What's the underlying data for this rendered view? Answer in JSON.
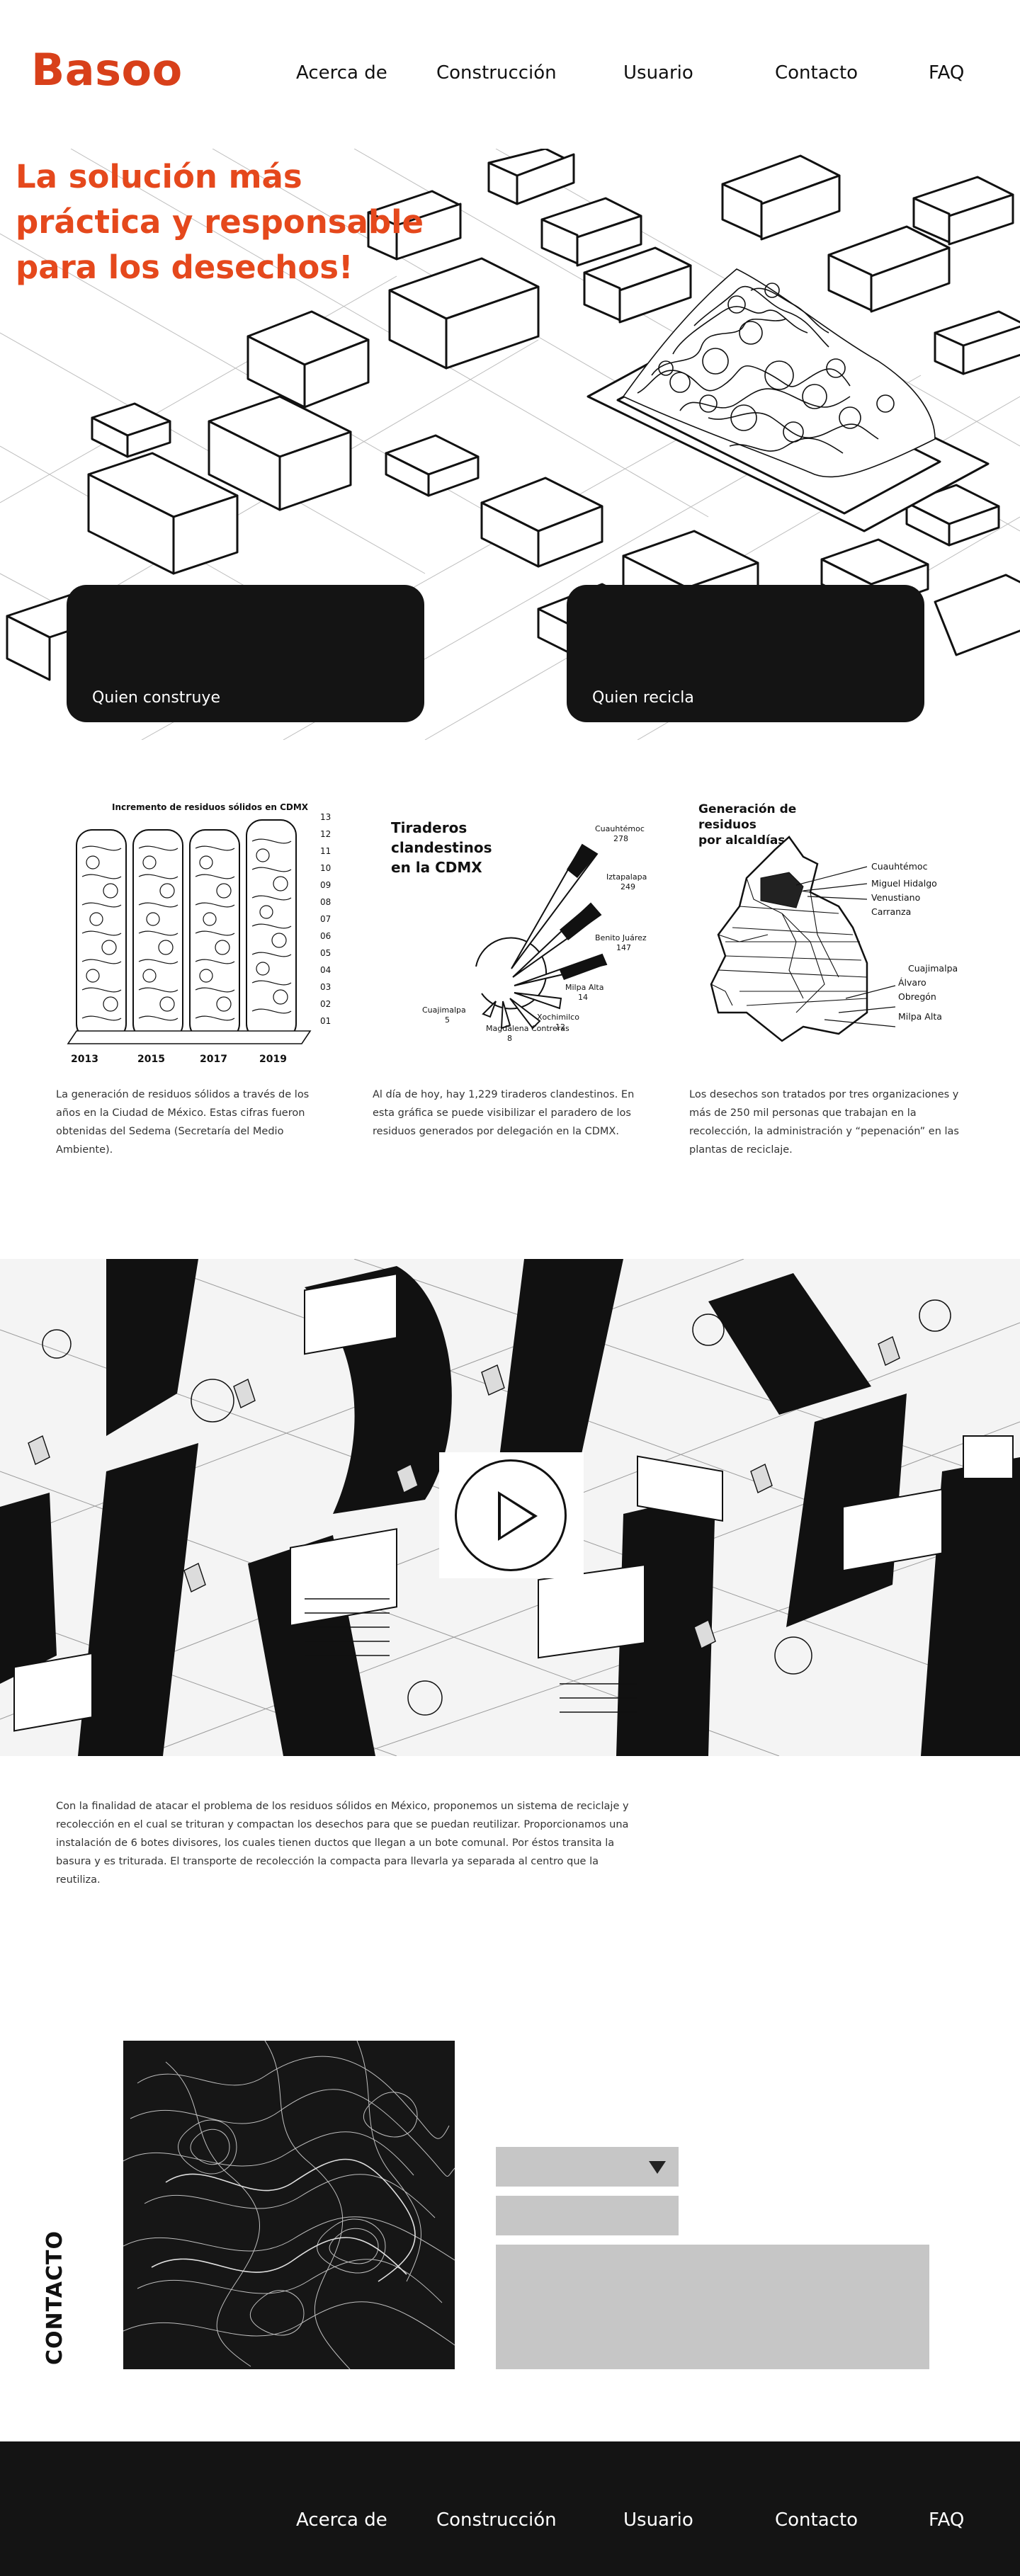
{
  "header": {
    "logo": "Basoo",
    "nav": [
      "Acerca de",
      "Construcción",
      "Usuario",
      "Contacto",
      "FAQ"
    ]
  },
  "hero": {
    "title": "La solución más práctica y responsable para los desechos!",
    "cards": [
      "Quien construye",
      "Quien recicla"
    ]
  },
  "info": {
    "fig1": {
      "title": "Incremento de residuos sólidos en CDMX",
      "years": [
        "2013",
        "2015",
        "2017",
        "2019"
      ],
      "scale": [
        "13",
        "12",
        "11",
        "10",
        "09",
        "08",
        "07",
        "06",
        "05",
        "04",
        "03",
        "02",
        "01"
      ],
      "text": "La generación de residuos sólidos a través de los años en la Ciudad de México. Estas cifras fueron obtenidas del Sedema (Secretaría del Medio Ambiente)."
    },
    "fig2": {
      "title": [
        "Tiraderos",
        "clandestinos",
        "en la CDMX"
      ],
      "labels": [
        {
          "name": "Cuauhtémoc",
          "value": "278"
        },
        {
          "name": "Iztapalapa",
          "value": "249"
        },
        {
          "name": "Benito Juárez",
          "value": "147"
        },
        {
          "name": "Milpa Alta",
          "value": "14"
        },
        {
          "name": "Xochimilco",
          "value": "12"
        },
        {
          "name": "Magdalena Contreras",
          "value": "8"
        },
        {
          "name": "Cuajimalpa",
          "value": "5"
        }
      ],
      "text": "Al día de hoy, hay 1,229 tiraderos clandestinos. En esta gráfica se puede visibilizar el paradero de los residuos generados por delegación en la CDMX."
    },
    "fig3": {
      "title": [
        "Generación de",
        "residuos",
        "por alcaldías"
      ],
      "labels": [
        "Cuauhtémoc",
        "Miguel Hidalgo",
        "Venustiano",
        "Carranza",
        "Cuajimalpa",
        "Álvaro",
        "Obregón",
        "Milpa Alta"
      ],
      "text": "Los desechos son tratados por tres organizaciones y más de 250 mil personas que trabajan en la recolección, la administración y “pepenación” en las plantas de reciclaje."
    }
  },
  "video": {
    "description": "Con la finalidad de atacar el problema de los residuos sólidos en México, proponemos un sistema de reciclaje y recolección en el cual se trituran y compactan los desechos para que se puedan reutilizar. Proporcionamos una instalación de 6 botes divisores, los cuales tienen ductos que llegan a un bote comunal. Por éstos transita la basura y es triturada. El transporte de recolección la compacta para llevarla ya separada al centro que la reutiliza."
  },
  "contact": {
    "heading": "CONTACTO"
  },
  "footer": {
    "nav": [
      "Acerca de",
      "Construcción",
      "Usuario",
      "Contacto",
      "FAQ"
    ]
  },
  "colors": {
    "accent": "#e5481c",
    "dark": "#141414",
    "field": "#c6c6c6"
  }
}
